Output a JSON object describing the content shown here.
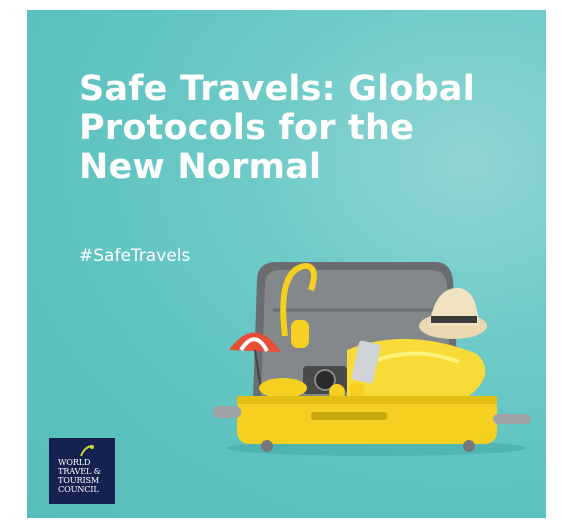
{
  "headline": {
    "line1": "Safe Travels: Global",
    "line2": "Protocols for the",
    "line3": "New Normal"
  },
  "hashtag": "#SafeTravels",
  "logo": {
    "line1": "WORLD",
    "line2": "TRAVEL &",
    "line3": "TOURISM",
    "line4": "COUNCIL"
  },
  "colors": {
    "background": "#5cc2bf",
    "suitcase": "#f5d020",
    "logo_bg": "#15214f",
    "text": "#ffffff"
  }
}
